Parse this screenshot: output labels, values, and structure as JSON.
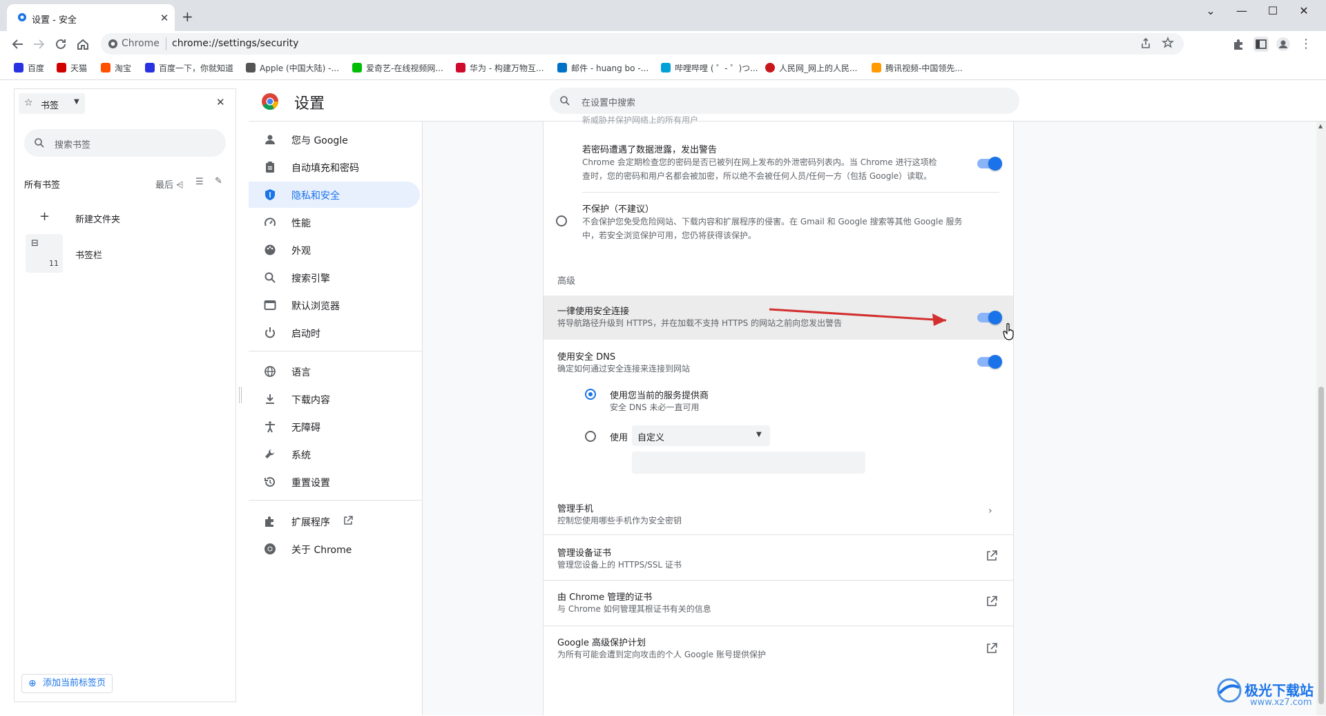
{
  "browser": {
    "tab_title": "设置 - 安全",
    "omnibox_site": "Chrome",
    "url": "chrome://settings/security",
    "bookmarks": [
      {
        "label": "百度",
        "color": "#2932e1"
      },
      {
        "label": "天猫",
        "color": "#d00000"
      },
      {
        "label": "淘宝",
        "color": "#ff5000"
      },
      {
        "label": "百度一下，你就知道",
        "color": "#2932e1"
      },
      {
        "label": "Apple (中国大陆) -...",
        "color": "#555555"
      },
      {
        "label": "爱奇艺-在线视频网...",
        "color": "#00be06"
      },
      {
        "label": "华为 - 构建万物互...",
        "color": "#cf0a2c"
      },
      {
        "label": "邮件 - huang bo -...",
        "color": "#0072c6"
      },
      {
        "label": "哔哩哔哩 ( ゜- ゜)つ...",
        "color": "#00a1d6"
      },
      {
        "label": "人民网_网上的人民...",
        "color": "#c8161d"
      },
      {
        "label": "腾讯视频-中国领先...",
        "color": "#ff9a00"
      }
    ]
  },
  "side_panel": {
    "header": "书签",
    "search_placeholder": "搜索书签",
    "all_bookmarks": "所有书签",
    "sort_label": "最后",
    "new_folder": "新建文件夹",
    "bookmarks_bar": "书签栏",
    "bookmarks_bar_count": "11",
    "add_current_tab": "添加当前标签页"
  },
  "settings": {
    "title": "设置",
    "search_placeholder": "在设置中搜索",
    "nav": [
      {
        "label": "您与 Google",
        "icon": "person-icon"
      },
      {
        "label": "自动填充和密码",
        "icon": "clipboard-icon"
      },
      {
        "label": "隐私和安全",
        "icon": "shield-icon"
      },
      {
        "label": "性能",
        "icon": "speedometer-icon"
      },
      {
        "label": "外观",
        "icon": "palette-icon"
      },
      {
        "label": "搜索引擎",
        "icon": "search-icon"
      },
      {
        "label": "默认浏览器",
        "icon": "browser-icon"
      },
      {
        "label": "启动时",
        "icon": "power-icon"
      },
      {
        "label": "语言",
        "icon": "globe-icon"
      },
      {
        "label": "下载内容",
        "icon": "download-icon"
      },
      {
        "label": "无障碍",
        "icon": "accessibility-icon"
      },
      {
        "label": "系统",
        "icon": "wrench-icon"
      },
      {
        "label": "重置设置",
        "icon": "history-icon"
      },
      {
        "label": "扩展程序",
        "icon": "puzzle-icon"
      },
      {
        "label": "关于 Chrome",
        "icon": "chrome-icon"
      }
    ],
    "content": {
      "truncated_top": "新威胁并保护网络上的所有用户",
      "leak_warning_title": "若密码遭遇了数据泄露，发出警告",
      "leak_warning_desc_1": "Chrome 会定期检查您的密码是否已被列在网上发布的外泄密码列表内。当 Chrome 进行这项检",
      "leak_warning_desc_2": "查时，您的密码和用户名都会被加密，所以绝不会被任何人员/任何一方（包括 Google）读取。",
      "no_protection_title": "不保护（不建议）",
      "no_protection_desc_1": "不会保护您免受危险网站、下载内容和扩展程序的侵害。在 Gmail 和 Google 搜索等其他 Google 服务",
      "no_protection_desc_2": "中，若安全浏览保护可用，您仍将获得该保护。",
      "advanced_heading": "高级",
      "https_title": "一律使用安全连接",
      "https_desc": "将导航路径升级到 HTTPS，并在加载不支持 HTTPS 的网站之前向您发出警告",
      "dns_title": "使用安全 DNS",
      "dns_desc": "确定如何通过安全连接来连接到网站",
      "dns_current_provider": "使用您当前的服务提供商",
      "dns_current_provider_desc": "安全 DNS 未必一直可用",
      "dns_use": "使用",
      "dns_custom_select": "自定义",
      "phones_title": "管理手机",
      "phones_desc": "控制您使用哪些手机作为安全密钥",
      "device_certs_title": "管理设备证书",
      "device_certs_desc": "管理您设备上的 HTTPS/SSL 证书",
      "chrome_certs_title": "由 Chrome 管理的证书",
      "chrome_certs_desc": "与 Chrome 如何管理其根证书有关的信息",
      "advanced_protection_title": "Google 高级保护计划",
      "advanced_protection_desc": "为所有可能会遭到定向攻击的个人 Google 账号提供保护"
    }
  },
  "watermark": {
    "brand": "极光下载站",
    "url": "www.xz7.com"
  },
  "colors": {
    "accent": "#1a73e8",
    "active_nav_bg": "#e8f0fe",
    "annotation_arrow": "#d32f2f"
  }
}
